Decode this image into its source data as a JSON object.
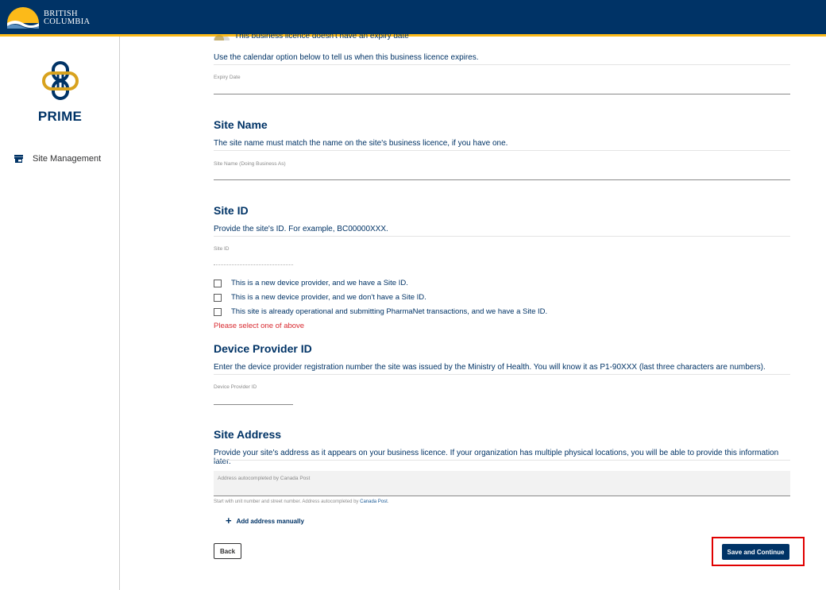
{
  "header": {
    "logo_line1": "BRITISH",
    "logo_line2": "COLUMBIA"
  },
  "sidebar": {
    "app_name": "PRIME",
    "items": [
      {
        "label": "Site Management",
        "icon": "storefront-icon"
      }
    ]
  },
  "expiry": {
    "toggle_label": "This business licence doesn't have an expiry date",
    "hint": "Use the calendar option below to tell us when this business licence expires.",
    "field_label": "Expiry Date"
  },
  "site_name": {
    "heading": "Site Name",
    "hint": "The site name must match the name on the site's business licence, if you have one.",
    "field_label": "Site Name (Doing Business As)"
  },
  "site_id": {
    "heading": "Site ID",
    "hint": "Provide the site's ID. For example, BC00000XXX.",
    "field_label": "Site ID",
    "options": [
      "This is a new device provider, and we have a Site ID.",
      "This is a new device provider, and we don't have a Site ID.",
      "This site is already operational and submitting PharmaNet transactions, and we have a Site ID."
    ],
    "error": "Please select one of above"
  },
  "device_provider": {
    "heading": "Device Provider ID",
    "hint": "Enter the device provider registration number the site was issued by the Ministry of Health. You will know it as P1-90XXX (last three characters are numbers).",
    "field_label": "Device Provider ID"
  },
  "site_address": {
    "heading": "Site Address",
    "hint": "Provide your site's address as it appears on your business licence. If your organization has multiple physical locations, you will be able to provide this information later.",
    "placeholder": "Address autocompleted by Canada Post",
    "help_prefix": "Start with unit number and street number. Address autocompleted by ",
    "help_link": "Canada Post",
    "help_suffix": ".",
    "add_manual": "Add address manually"
  },
  "actions": {
    "back": "Back",
    "save": "Save and Continue"
  },
  "colors": {
    "primary": "#003366",
    "accent": "#fcba19",
    "error": "#d8292f",
    "highlight": "#e00000"
  }
}
